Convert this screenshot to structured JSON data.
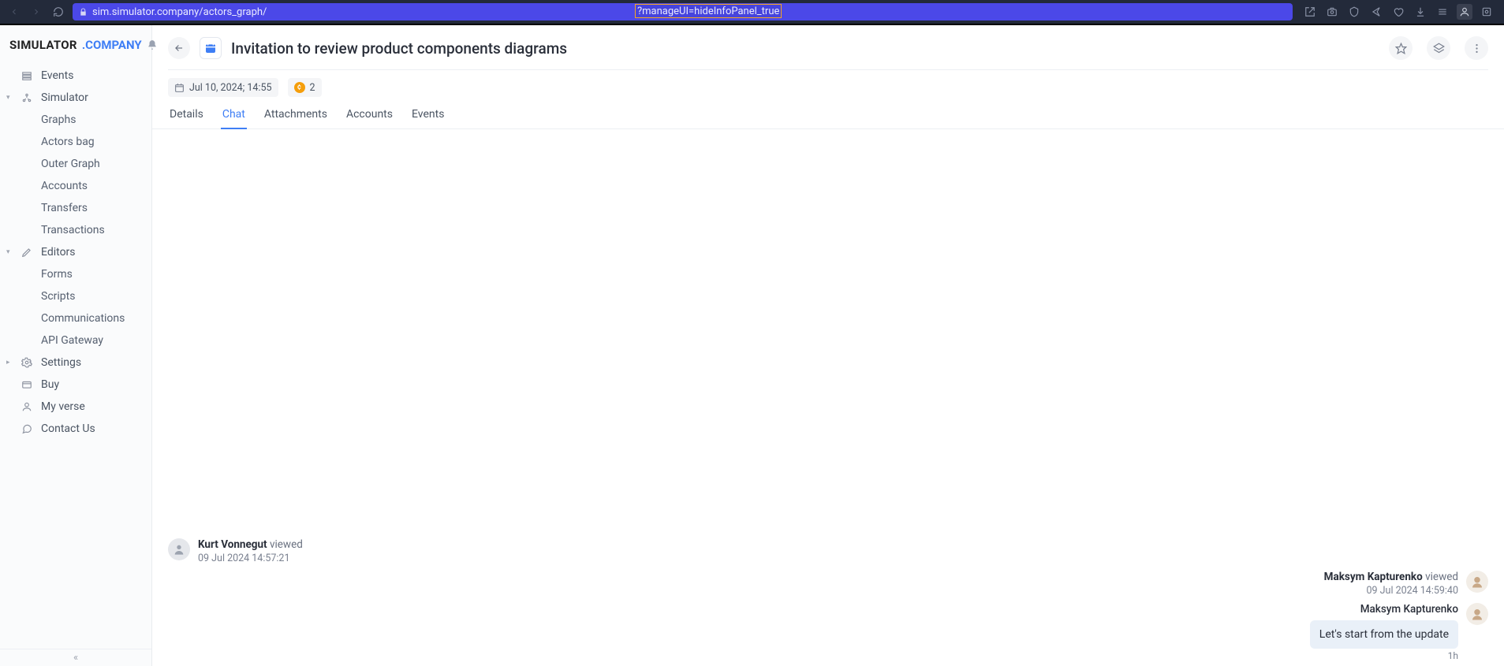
{
  "browser": {
    "url_base": "sim.simulator.company/actors_graph/",
    "url_query": "?manageUI=hideInfoPanel_true"
  },
  "logo": {
    "part1": "SIMULATOR",
    "part2": ".COMPANY"
  },
  "sidebar": {
    "events": "Events",
    "simulator": "Simulator",
    "simulator_items": [
      "Graphs",
      "Actors bag",
      "Outer Graph",
      "Accounts",
      "Transfers",
      "Transactions"
    ],
    "editors": "Editors",
    "editors_items": [
      "Forms",
      "Scripts",
      "Communications",
      "API Gateway"
    ],
    "settings": "Settings",
    "buy": "Buy",
    "my_verse": "My verse",
    "contact": "Contact Us"
  },
  "header": {
    "title": "Invitation to review product components diagrams",
    "date": "Jul 10, 2024; 14:55",
    "coin_count": "2"
  },
  "tabs": [
    "Details",
    "Chat",
    "Attachments",
    "Accounts",
    "Events"
  ],
  "active_tab_index": 1,
  "chat": {
    "left1": {
      "name": "Kurt Vonnegut",
      "action": "viewed",
      "time": "09 Jul 2024 14:57:21"
    },
    "right1": {
      "name": "Maksym Kapturenko",
      "action": "viewed",
      "time": "09 Jul 2024 14:59:40"
    },
    "right2": {
      "name": "Maksym Kapturenko",
      "bubble": "Let's start from the update",
      "ago": "1h"
    }
  }
}
